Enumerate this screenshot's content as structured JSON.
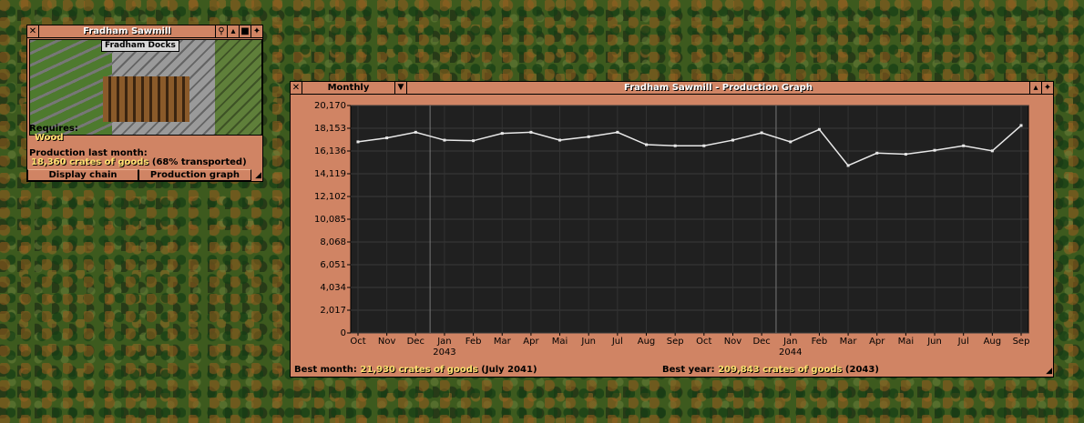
{
  "industry_window": {
    "title": "Fradham Sawmill",
    "viewport_label": "Fradham Docks",
    "requires_label": "Requires:",
    "requires_value": "Wood",
    "production_label": "Production last month:",
    "production_value": "18,360 crates of goods",
    "production_transported": "(68% transported)",
    "buttons": {
      "display_chain": "Display chain",
      "production_graph": "Production graph"
    }
  },
  "graph_window": {
    "title": "Fradham Sawmill - Production Graph",
    "period_dropdown": "Monthly",
    "best_month_label": "Best month:",
    "best_month_value": "21,930 crates of goods",
    "best_month_when": "(July 2041)",
    "best_year_label": "Best year:",
    "best_year_value": "209,843 crates of goods",
    "best_year_when": "(2043)"
  },
  "chart_data": {
    "type": "line",
    "y_ticks": [
      "0",
      "2,017",
      "4,034",
      "6,051",
      "8,068",
      "10,085",
      "12,102",
      "14,119",
      "16,136",
      "18,153",
      "20,170"
    ],
    "ylim": [
      0,
      20170
    ],
    "categories": [
      "Oct",
      "Nov",
      "Dec",
      "Jan",
      "Feb",
      "Mar",
      "Apr",
      "Mai",
      "Jun",
      "Jul",
      "Aug",
      "Sep",
      "Oct",
      "Nov",
      "Dec",
      "Jan",
      "Feb",
      "Mar",
      "Apr",
      "Mai",
      "Jun",
      "Jul",
      "Aug",
      "Sep"
    ],
    "year_labels": [
      {
        "index": 3,
        "label": "2043"
      },
      {
        "index": 15,
        "label": "2044"
      }
    ],
    "values": [
      16950,
      17300,
      17800,
      17100,
      17050,
      17700,
      17800,
      17100,
      17400,
      17800,
      16700,
      16600,
      16600,
      17100,
      17750,
      16950,
      18050,
      14850,
      15950,
      15850,
      16200,
      16600,
      16150,
      18400
    ],
    "line_color": "#e8e8e8",
    "background": "#202020",
    "grid": true
  }
}
